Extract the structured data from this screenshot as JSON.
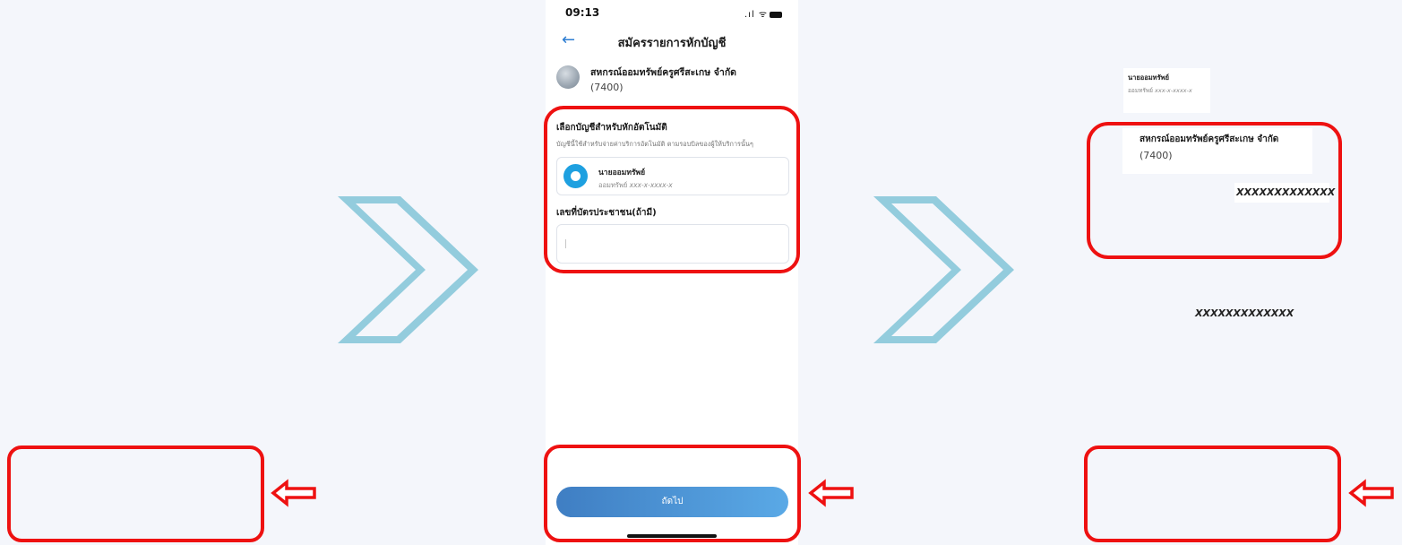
{
  "status_bar": {
    "time": "09:13",
    "icons": ".ıl ᯤ"
  },
  "header": {
    "title": "สมัครรายการหักบัญชี"
  },
  "cooperative": {
    "name": "สหกรณ์ออมทรัพย์ครูศรีสะเกษ จำกัด",
    "code": "(7400)"
  },
  "account_section": {
    "heading": "เลือกบัญชีสำหรับหักอัตโนมัติ",
    "description": "บัญชีนี้ใช้สำหรับจ่ายค่าบริการอัตโนมัติ ตามรอบบิลของผู้ให้บริการนั้นๆ",
    "account": {
      "name": "นายออมทรัพย์",
      "type_label": "ออมทรัพย์",
      "number": "xxx-x-xxxx-x"
    }
  },
  "id_section": {
    "heading": "เลขที่บัตรประชาชน(ถ้ามี)",
    "value": ""
  },
  "buttons": {
    "next": "ถัดไป"
  },
  "result_panel": {
    "account_name": "นายออมทรัพย์",
    "account_type": "ออมทรัพย์",
    "account_number": "xxx-x-xxxx-x",
    "coop_name": "สหกรณ์ออมทรัพย์ครูศรีสะเกษ จำกัด",
    "coop_code": "(7400)",
    "masked_id_1": "XXXXXXXXXXXXX",
    "masked_id_2": "XXXXXXXXXXXXX"
  },
  "colors": {
    "highlight": "#ee1111",
    "chevron": "#93ccdd",
    "button_gradient_start": "#3f7ec3",
    "button_gradient_end": "#5aa9e6",
    "accent": "#2d7dd2"
  },
  "icons": {
    "chevron": "chevron-right-icon",
    "arrow": "left-arrow-icon",
    "back": "back-arrow-icon",
    "signal": "signal-icon",
    "wifi": "wifi-icon",
    "battery": "battery-icon"
  }
}
